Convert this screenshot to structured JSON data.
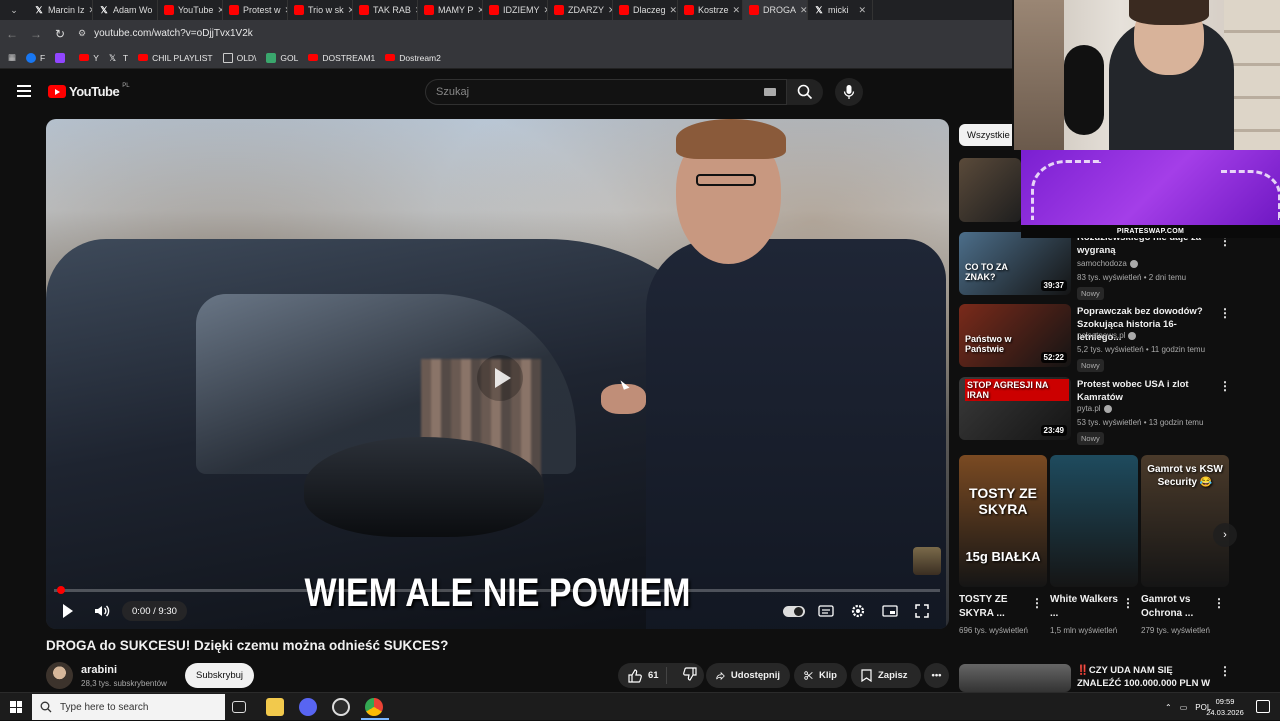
{
  "browser": {
    "tabs": [
      {
        "label": "Marcin Iz",
        "icon": "x"
      },
      {
        "label": "Adam Wo",
        "icon": "x"
      },
      {
        "label": "YouTube",
        "icon": "yt"
      },
      {
        "label": "Protest w",
        "icon": "yt"
      },
      {
        "label": "Trio w sk",
        "icon": "yt"
      },
      {
        "label": "TAK RAB",
        "icon": "yt"
      },
      {
        "label": "MAMY P",
        "icon": "yt"
      },
      {
        "label": "IDZIEMY",
        "icon": "yt"
      },
      {
        "label": "ZDARZY",
        "icon": "yt"
      },
      {
        "label": "Dlaczeg",
        "icon": "yt"
      },
      {
        "label": "Kostrze",
        "icon": "yt"
      },
      {
        "label": "DROGA",
        "icon": "yt",
        "active": true
      },
      {
        "label": "micki",
        "icon": "x"
      }
    ],
    "url": "youtube.com/watch?v=oDjjTvx1V2k",
    "bookmarks": [
      {
        "label": "F",
        "icon": "facebook-icon",
        "color": "#1877f2"
      },
      {
        "label": "",
        "icon": "twitch-icon",
        "color": "#9146ff"
      },
      {
        "label": "Y",
        "icon": "youtube-icon",
        "color": "#ff0000"
      },
      {
        "label": "T",
        "icon": "x-icon",
        "color": "#ffffff"
      },
      {
        "label": "CHIL PLAYLIST",
        "icon": "youtube-icon",
        "color": "#ff0000"
      },
      {
        "label": "OLD\\",
        "icon": "folder-icon",
        "color": "#cccccc"
      },
      {
        "label": "GOL",
        "icon": "gol-icon",
        "color": "#3aa76d"
      },
      {
        "label": "DOSTREAM1",
        "icon": "youtube-icon",
        "color": "#ff0000"
      },
      {
        "label": "Dostream2",
        "icon": "youtube-icon",
        "color": "#ff0000"
      }
    ]
  },
  "youtube": {
    "logo_text": "YouTube",
    "logo_region": "PL",
    "search_placeholder": "Szukaj",
    "filter_chip": "Wszystkie"
  },
  "player": {
    "caption": "WIEM ALE NIE POWIEM",
    "time": "0:00 / 9:30",
    "progress_fraction": 0.0
  },
  "video": {
    "title": "DROGA do SUKCESU! Dzięki czemu można odnieść SUKCES?",
    "channel": "arabini",
    "subscribers": "28,3 tys. subskrybentów",
    "subscribe_label": "Subskrybuj",
    "likes": "61",
    "share_label": "Udostępnij",
    "clip_label": "Klip",
    "save_label": "Zapisz"
  },
  "recommendations": [
    {
      "title": "Rozdziewskiego nie daje za wygraną",
      "channel": "samochodoza",
      "meta": "83 tys. wyświetleń • 2 dni temu",
      "badge": "Nowy",
      "duration": "39:37",
      "thumb_text": "CO TO ZA ZNAK?",
      "thumb_color": "#4c6e8a"
    },
    {
      "title": "Poprawczak bez dowodów? Szokująca historia 16-letniego...",
      "channel": "polsatnews.pl",
      "meta": "5,2 tys. wyświetleń • 11 godzin temu",
      "badge": "Nowy",
      "duration": "52:22",
      "thumb_text": "Państwo w Państwie",
      "thumb_color": "#7a2a1a"
    },
    {
      "title": "Protest wobec USA i zlot Kamratów",
      "channel": "pyta.pl",
      "meta": "53 tys. wyświetleń • 13 godzin temu",
      "badge": "Nowy",
      "duration": "23:49",
      "thumb_text": "STOP AGRESJI NA IRAN",
      "thumb_color": "#3a3a3a"
    }
  ],
  "shorts": [
    {
      "title": "TOSTY ZE SKYRA ...",
      "views": "696 tys. wyświetleń",
      "thumb_top": "TOSTY ZE SKYRA",
      "thumb_bottom": "15g BIAŁKA",
      "thumb_color": "#7a4a22"
    },
    {
      "title": "White Walkers ...",
      "views": "1,5 mln wyświetleń",
      "thumb_top": "",
      "thumb_bottom": "",
      "thumb_color": "#1e4b5e"
    },
    {
      "title": "Gamrot vs Ochrona ...",
      "views": "279 tys. wyświetleń",
      "thumb_top": "Gamrot vs KSW Security 😂",
      "thumb_bottom": "",
      "thumb_color": "#4a3a2a"
    }
  ],
  "next_rec": {
    "title": "‼️CZY UDA NAM SIĘ ZNALEŹĆ 100.000.000 PLN W AUTACH ..."
  },
  "overlay": {
    "ad_text": "PIRATESWAP.COM"
  },
  "taskbar": {
    "search_placeholder": "Type here to search",
    "language": "POL",
    "time": "09:59",
    "date": "24.03.2026"
  }
}
